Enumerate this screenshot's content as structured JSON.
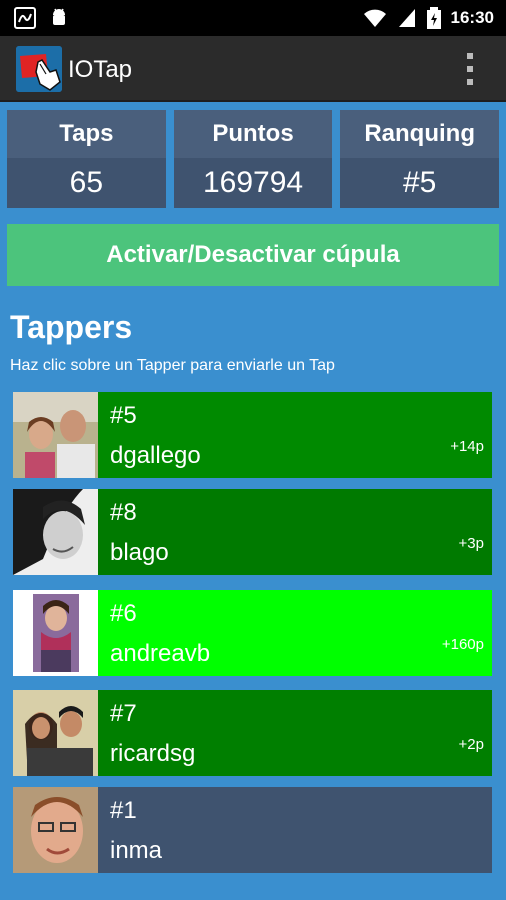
{
  "status_bar": {
    "time": "16:30"
  },
  "app": {
    "title": "IOTap"
  },
  "stats": [
    {
      "label": "Taps",
      "value": "65"
    },
    {
      "label": "Puntos",
      "value": "169794"
    },
    {
      "label": "Ranquing",
      "value": "#5"
    }
  ],
  "toggle_label": "Activar/Desactivar cúpula",
  "section": {
    "title": "Tappers",
    "subtitle": "Haz clic sobre un Tapper para enviarle un Tap"
  },
  "tappers": [
    {
      "rank": "#5",
      "name": "dgallego",
      "points": "+14p",
      "color": "#008a00"
    },
    {
      "rank": "#8",
      "name": "blago",
      "points": "+3p",
      "color": "#007a00"
    },
    {
      "rank": "#6",
      "name": "andreavb",
      "points": "+160p",
      "color": "#00ff00"
    },
    {
      "rank": "#7",
      "name": "ricardsg",
      "points": "+2p",
      "color": "#007f00"
    },
    {
      "rank": "#1",
      "name": "inma",
      "points": "",
      "color": "#3f536f"
    }
  ],
  "colors": {
    "background": "#3a8fcf",
    "appbar": "#2b2b2b",
    "stat_header": "#4a5f7c",
    "stat_value": "#3f536f",
    "toggle": "#4cc47c"
  }
}
